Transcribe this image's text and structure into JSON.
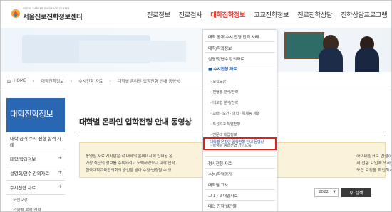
{
  "brand": {
    "subtitle": "SEOUL CAREER GUIDANCE CENTER",
    "title": "서울진로진학정보센터"
  },
  "gnb": [
    {
      "label": "진로정보",
      "active": false
    },
    {
      "label": "진로검사",
      "active": false
    },
    {
      "label": "대학진학정보",
      "active": true
    },
    {
      "label": "고교진학정보",
      "active": false
    },
    {
      "label": "진로진학상담",
      "active": false
    },
    {
      "label": "진학상담프로그램",
      "active": false
    }
  ],
  "breadcrumb": {
    "home": "HOME",
    "items": [
      "대학진학정보",
      "수시전형 자료",
      "대학별 온라인 입학전형 안내 동영상"
    ]
  },
  "sidebar": {
    "title": "대학진학정보",
    "items": [
      {
        "label": "대학 공개 수시 전형 합격 사례",
        "has_plus": false
      },
      {
        "label": "대학/학과정보",
        "has_plus": true
      },
      {
        "label": "설명회/연수 강의자료",
        "has_plus": true
      },
      {
        "label": "수시전형 자료",
        "has_plus": true
      }
    ],
    "subitems": [
      "모집요강",
      "전형별 분석/전략"
    ]
  },
  "main": {
    "title": "대학별 온라인 입학전형 안내 동영상",
    "notice_left": [
      "동영상 자료 게시판은 각 대학의 홈페이지에 탑재된 온",
      "가장 최근의 정보를 수록하려고 노력하였으나 대학 입학",
      "한국대학교육협의회의 승인을 받아 수정·변경될 수 있"
    ],
    "notice_right": [
      "하이퍼링크로 연결하였습니다.",
      "시 전형 요인에 의하여 7월 중에",
      "모집 요강을 확인하시기 바랍니다."
    ],
    "year": "2022",
    "search_label": "검색"
  },
  "dropdown": {
    "items": [
      {
        "label": "대학 공개 수시 전형 합격 사례",
        "type": "item"
      },
      {
        "label": "대학/학과정보",
        "type": "item"
      },
      {
        "label": "설명회/연수 강의자료",
        "type": "item"
      },
      {
        "label": "■ 수시전형 자료",
        "type": "active"
      },
      {
        "label": "- 모집요강",
        "type": "sub"
      },
      {
        "label": "- 전형별 분석/전략",
        "type": "sub"
      },
      {
        "label": "- 대교협 분석/전략",
        "type": "sub"
      },
      {
        "label": "- 교대 · 보건 · 의학 · 예체능 계열",
        "type": "sub"
      },
      {
        "label": "- 특성화고 특별전형",
        "type": "sub"
      },
      {
        "label": "- 전문대 대입정보",
        "type": "sub"
      },
      {
        "label": "- 학생부 종합전형 가이드북",
        "type": "sub"
      },
      {
        "label": "- 대학별 온라인 입학전형 안내 동영상",
        "type": "highlight"
      },
      {
        "label": "정시전형 자료",
        "type": "item"
      },
      {
        "label": "수능/학력평가",
        "type": "item"
      },
      {
        "label": "대학별 고사",
        "type": "item"
      },
      {
        "label": "고 1 · 2 대입자료",
        "type": "item"
      },
      {
        "label": "대입 진학 발간물",
        "type": "item"
      }
    ]
  }
}
